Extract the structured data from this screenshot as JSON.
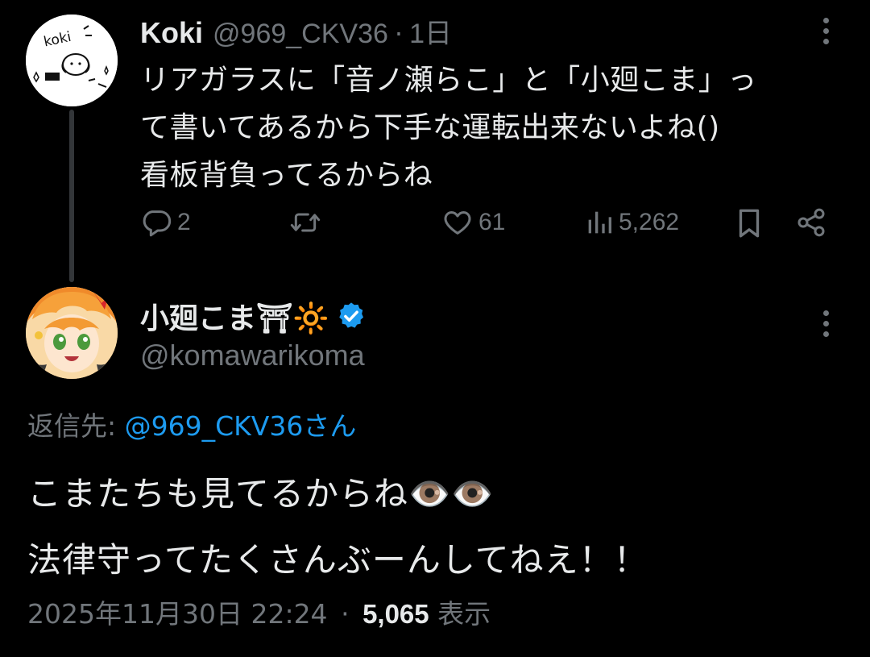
{
  "parent_tweet": {
    "author_name": "Koki",
    "handle": "@969_CKV36",
    "separator": "·",
    "time": "1日",
    "text": "リアガラスに「音ノ瀬らこ」と「小廻こま」っ\nて書いてあるから下手な運転出来ないよね()\n看板背負ってるからね",
    "avatar_text": "koki",
    "replies": "2",
    "likes": "61",
    "views": "5,262",
    "icons": {
      "reply": "reply-icon",
      "retweet": "retweet-icon",
      "like": "heart-icon",
      "views": "analytics-icon",
      "bookmark": "bookmark-icon",
      "share": "share-icon",
      "more": "more-icon"
    }
  },
  "main_tweet": {
    "author_name": "小廻こま⛩🔆",
    "handle": "@komawarikoma",
    "verified": true,
    "reply_label": "返信先: ",
    "reply_to": "@969_CKV36さん",
    "text": "こまたちも見てるからね👁️👁️\n法律守ってたくさんぶーんしてねえ！！",
    "timestamp": "2025年11月30日 22:24",
    "separator": "·",
    "view_count": "5,065",
    "view_label": "表示"
  },
  "colors": {
    "background": "#000000",
    "text_primary": "#e7e9ea",
    "text_secondary": "#71767b",
    "accent": "#1d9bf0",
    "thread_line": "#333639"
  }
}
